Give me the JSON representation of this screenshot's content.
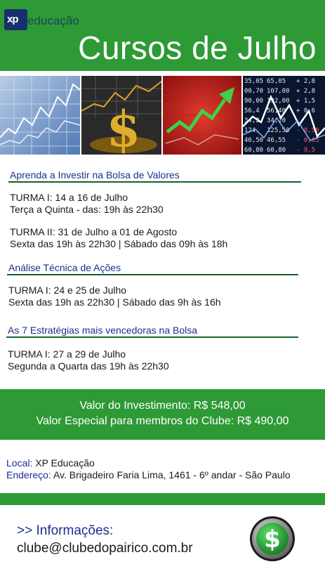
{
  "header": {
    "logo_mark": "xp",
    "logo_text": "educação",
    "title": "Cursos de Julho"
  },
  "photos": [
    "stock-line-chart-photo",
    "gold-dollar-sign-photo",
    "red-arrow-chart-photo",
    "stock-ticker-board-photo"
  ],
  "courses": [
    {
      "title": "Aprenda a Investir na Bolsa de Valores",
      "lines": [
        "TURMA I: 14 a 16 de Julho",
        "Terça a Quinta -  das: 19h às 22h30",
        "TURMA II: 31 de Julho a 01 de Agosto",
        "Sexta das 19h às 22h30 | Sábado das 09h às 18h"
      ]
    },
    {
      "title": "Análise Técnica de Ações",
      "lines": [
        "TURMA I: 24 e 25 de Julho",
        "Sexta das 19h as 22h30 | Sábado das 9h às 16h"
      ]
    },
    {
      "title": "As 7 Estratégias mais vencedoras na Bolsa",
      "lines": [
        "TURMA I: 27 a 29 de Julho",
        "Segunda a Quarta das 19h às 22h30"
      ]
    }
  ],
  "pricing": {
    "regular": "Valor do Investimento: R$ 548,00",
    "members": "Valor Especial para membros do Clube: R$ 490,00"
  },
  "location": {
    "local_label": "Local:",
    "local_value": " XP Educação",
    "address_label": "Endereço:",
    "address_value": " Av. Brigadeiro Faria Lima, 1461 - 6º andar - São Paulo"
  },
  "footer": {
    "info_title": ">> Informações:",
    "email": "clube@clubedopairico.com.br",
    "coin_symbol": "$",
    "coin_icon": "dollar-coin-icon"
  },
  "colors": {
    "brand_green": "#2e9a36",
    "title_blue": "#1d2f8f",
    "rule_green": "#17602c",
    "logo_navy": "#17306b"
  }
}
